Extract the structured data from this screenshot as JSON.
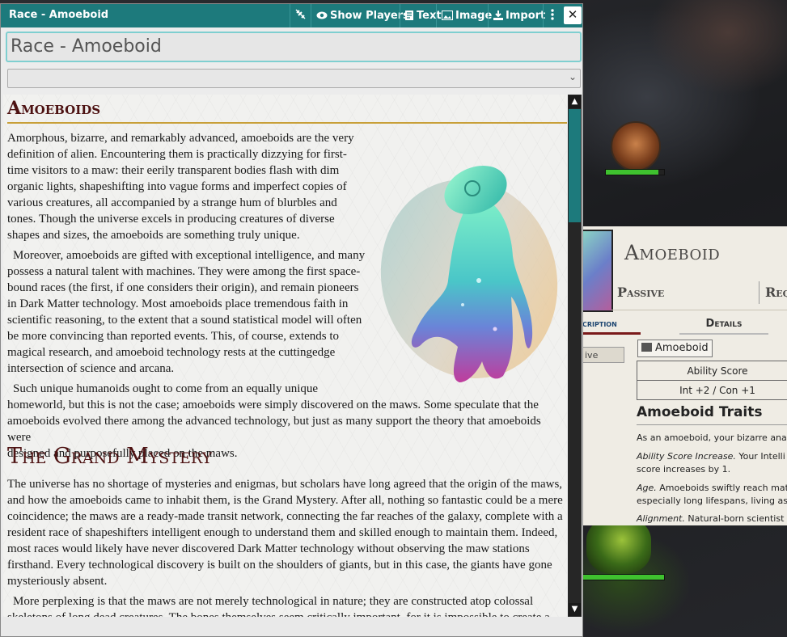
{
  "window": {
    "title": "Race - Amoeboid",
    "buttons": {
      "show_players": "Show Players",
      "text": "Text",
      "image": "Image",
      "import": "Import",
      "close": "✕"
    },
    "name_value": "Race - Amoeboid",
    "select_value": ""
  },
  "article": {
    "heading": "Amoeboids",
    "para1": [
      "Amorphous, bizarre, and remarkably advanced, amoeboids are the very",
      "definition of alien. Encountering them is practically dizzying for first-",
      "time visitors to a maw: their eerily transparent bodies flash with dim",
      "organic lights, shapeshifting into vague forms and imperfect copies of",
      "various creatures, all accompanied by a strange hum of blurbles and",
      "tones. Though the universe excels in producing creatures of diverse",
      "shapes and sizes, the amoeboids are something truly unique."
    ],
    "para2": [
      "Moreover, amoeboids are gifted with exceptional intelligence, and many",
      "possess a natural talent with machines. They were among the first space-",
      "bound races (the first, if one considers their origin), and remain pioneers",
      "in Dark Matter technology. Most amoeboids place tremendous faith in",
      "scientific reasoning, to the extent that a sound statistical model will often",
      "be more convincing than reported events. This, of course, extends to",
      "magical research, and amoeboid technology rests at the cuttingedge",
      "intersection of science and arcana."
    ],
    "para3": [
      "Such unique humanoids ought to come from an equally unique",
      "homeworld, but this is not the case; amoeboids were simply  discovered on the maws. Some speculate that the",
      "amoeboids evolved there among the advanced technology, but just as many support the theory that amoeboids were",
      "designed and purposefully placed on the maws."
    ],
    "heading2": "The Grand Mystery",
    "para4": [
      "The universe has no shortage of mysteries and enigmas, but scholars have long agreed that the origin of the maws,",
      "and how the amoeboids came to inhabit them, is the Grand Mystery. After all, nothing so fantastic could be a mere",
      "coincidence; the maws are a ready-made transit network, connecting the far reaches of the galaxy, complete with a",
      "resident race of shapeshifters intelligent enough to understand them and skilled enough to maintain them. Indeed,",
      "most races would likely have never discovered Dark Matter technology without observing the maw stations",
      "firsthand. Every technological discovery is built on the shoulders of giants, but in this case, the giants have gone",
      "mysteriously absent."
    ],
    "para5": [
      "More perplexing is that the maws are not merely technological in nature; they are constructed atop colossal",
      "skeletons of long dead creatures. The bones themselves seem critically important, for it is impossible to create a"
    ]
  },
  "sheet": {
    "name": "Amoeboid",
    "passive": "Passive",
    "requires": "Requ",
    "tab_description": "cription",
    "tab_details": "Details",
    "pill_text": "ive",
    "tag_label": "Amoeboid",
    "ability_header": "Ability Score",
    "ability_value": "Int +2 / Con +1",
    "traits_title": "Amoeboid Traits",
    "line1": "As an amoeboid, your bizarre anat",
    "line2_italic": "Ability Score Increase.",
    "line2_rest": " Your Intelli",
    "line3": "score increases by 1.",
    "line4_italic": "Age.",
    "line4_rest": " Amoeboids swiftly reach mat",
    "line5": "especially long lifespans, living as",
    "line6_italic": "Alignment.",
    "line6_rest": " Natural-born scientist"
  },
  "colors": {
    "titlebar": "#1d7a7c",
    "heading": "#4d1212",
    "rule": "#c89f38",
    "hp": "#3fc12f"
  },
  "tokens": {
    "hp_top_fraction": 0.9,
    "hp_bottom_fraction": 1.0
  }
}
